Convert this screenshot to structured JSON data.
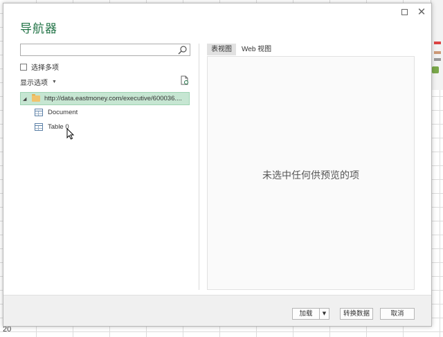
{
  "window": {
    "title": "导航器",
    "maximize_icon": "maximize-icon",
    "close_label": "✕"
  },
  "left_pane": {
    "search": {
      "value": "",
      "placeholder": ""
    },
    "select_multiple_label": "选择多项",
    "display_options_label": "显示选项",
    "display_options_caret": "▼",
    "tree": {
      "root": {
        "label": "http://data.eastmoney.com/executive/600036....",
        "expanded": true,
        "selected": true,
        "expander": "◢"
      },
      "children": [
        {
          "label": "Document",
          "icon": "table-icon"
        },
        {
          "label": "Table 0",
          "icon": "table-icon"
        }
      ]
    }
  },
  "right_pane": {
    "tabs": [
      {
        "label": "表视图",
        "active": true
      },
      {
        "label": "Web 视图",
        "active": false
      }
    ],
    "empty_message": "未选中任何供预览的项"
  },
  "footer": {
    "load_label": "加载",
    "load_dropdown": "▼",
    "transform_label": "转换数据",
    "cancel_label": "取消"
  },
  "background": {
    "row_number": "20",
    "accent_color": "#217346",
    "selection_color": "#c6e6d2"
  }
}
